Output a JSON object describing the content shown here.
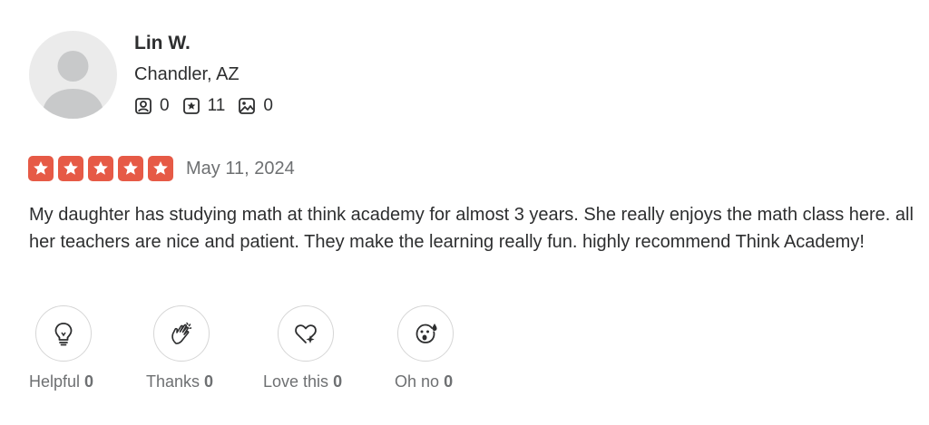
{
  "user": {
    "name": "Lin W.",
    "location": "Chandler, AZ",
    "stats": [
      {
        "icon": "friends-icon",
        "value": "0"
      },
      {
        "icon": "reviews-icon",
        "value": "11"
      },
      {
        "icon": "photos-icon",
        "value": "0"
      }
    ]
  },
  "review": {
    "rating": 5,
    "max_rating": 5,
    "date": "May 11, 2024",
    "text": "My daughter has studying math at think academy for almost 3 years. She really enjoys the math class here. all her teachers are nice and patient. They make the learning really fun. highly recommend Think Academy!"
  },
  "reactions": [
    {
      "label": "Helpful",
      "count": "0",
      "icon": "lightbulb-icon"
    },
    {
      "label": "Thanks",
      "count": "0",
      "icon": "clapping-hands-icon"
    },
    {
      "label": "Love this",
      "count": "0",
      "icon": "heart-sparkle-icon"
    },
    {
      "label": "Oh no",
      "count": "0",
      "icon": "surprised-face-icon"
    }
  ],
  "colors": {
    "star": "#e65a46",
    "text": "#2d2e2f",
    "muted": "#6e7072"
  }
}
